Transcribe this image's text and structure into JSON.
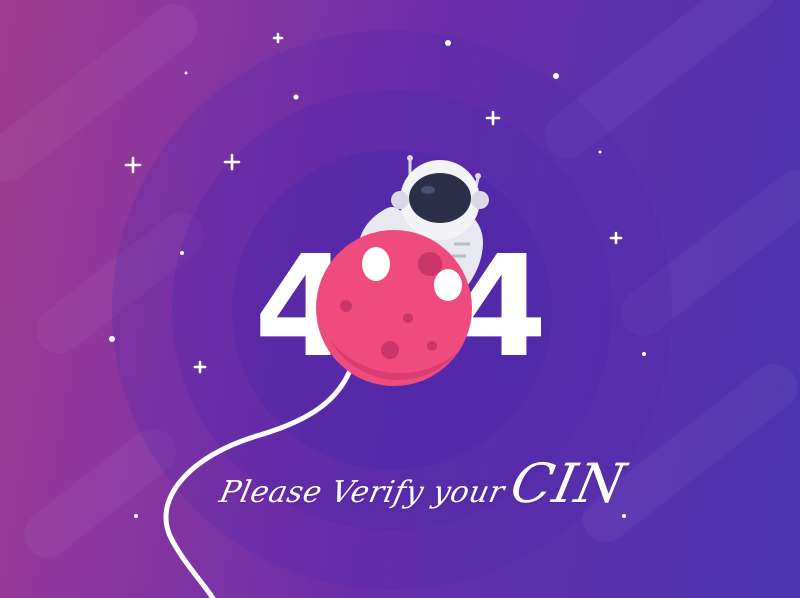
{
  "error": {
    "digit_left": "4",
    "digit_right": "4"
  },
  "message": {
    "lead_text": "Please Verify your",
    "emphasis_text": "CIN"
  },
  "colors": {
    "background_start": "#a13a8c",
    "background_end": "#4a34b0",
    "planet": "#ee4b7f",
    "planet_crater": "#c9366a",
    "suit": "#ffffff",
    "visor": "#2b2f4a",
    "text": "#ffffff"
  },
  "icons": {
    "astronaut": "astronaut-icon",
    "planet": "planet-icon",
    "star": "star-icon",
    "sparkle": "sparkle-icon"
  }
}
